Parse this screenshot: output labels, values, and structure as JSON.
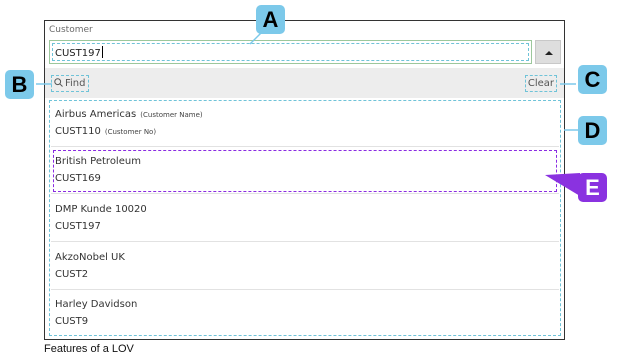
{
  "lov": {
    "field_label": "Customer",
    "input_value": "CUST197",
    "find_label": "Find",
    "clear_label": "Clear",
    "items": [
      {
        "name": "Airbus Americas",
        "name_hint": "(Customer Name)",
        "number": "CUST110",
        "number_hint": "(Customer No)"
      },
      {
        "name": "British Petroleum",
        "name_hint": "",
        "number": "CUST169",
        "number_hint": ""
      },
      {
        "name": "DMP Kunde 10020",
        "name_hint": "",
        "number": "CUST197",
        "number_hint": ""
      },
      {
        "name": "AkzoNobel UK",
        "name_hint": "",
        "number": "CUST2",
        "number_hint": ""
      },
      {
        "name": "Harley Davidson",
        "name_hint": "",
        "number": "CUST9",
        "number_hint": ""
      }
    ],
    "selected_index": 1
  },
  "callouts": {
    "a": "A",
    "b": "B",
    "c": "C",
    "d": "D",
    "e": "E"
  },
  "caption": "Features of a LOV",
  "colors": {
    "callout_blue": "#7cc9ea",
    "callout_purple": "#8a32e0",
    "guide_dash": "#6fc3d8",
    "select_dash": "#8a2be2"
  },
  "icons": {
    "find": "search-icon",
    "dropdown": "caret-up-icon"
  }
}
